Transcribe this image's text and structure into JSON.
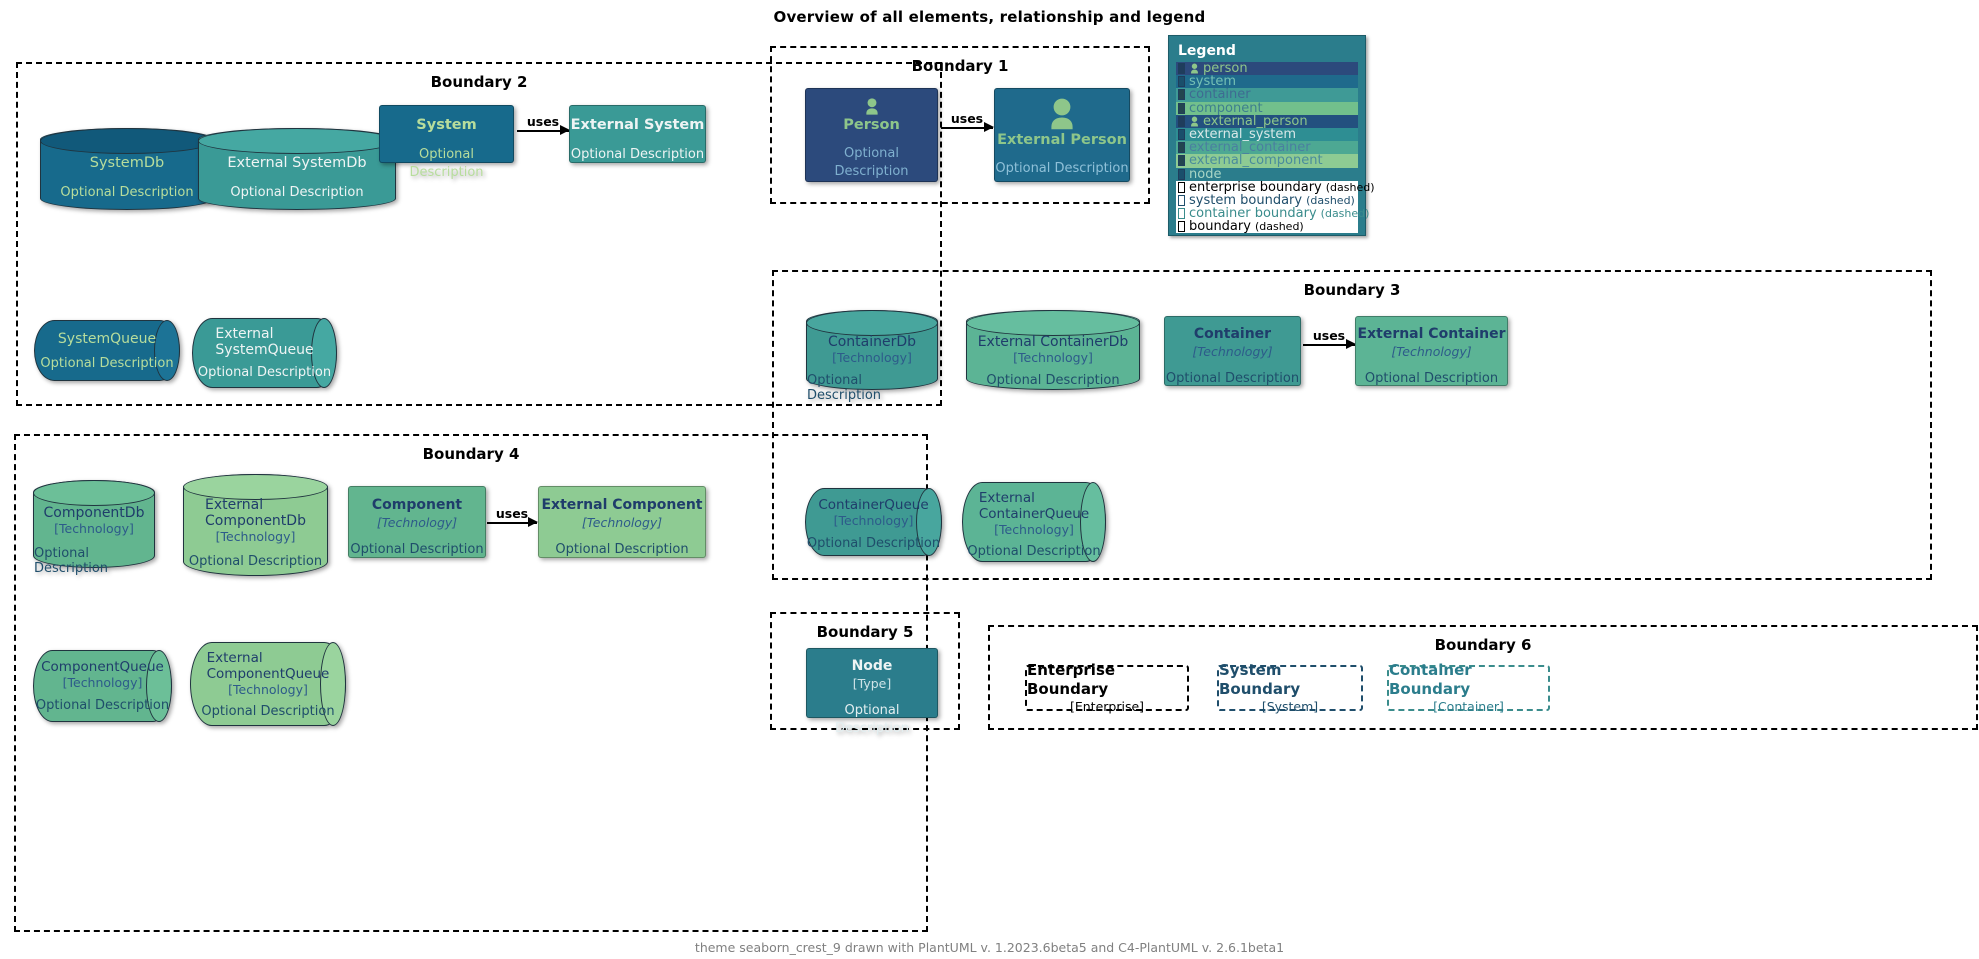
{
  "title": "Overview of all elements, relationship and legend",
  "footer": "theme seaborn_crest_9 drawn with PlantUML v. 1.2023.6beta5 and C4-PlantUML v. 2.6.1beta1",
  "labels": {
    "uses": "uses",
    "optional_description": "Optional Description",
    "technology": "[Technology]",
    "type": "[Type]",
    "dashed": "(dashed)"
  },
  "boundaries": {
    "b1": {
      "title": "Boundary 1"
    },
    "b2": {
      "title": "Boundary 2"
    },
    "b3": {
      "title": "Boundary 3"
    },
    "b4": {
      "title": "Boundary 4"
    },
    "b5": {
      "title": "Boundary 5"
    },
    "b6": {
      "title": "Boundary 6"
    }
  },
  "elements": {
    "person": {
      "name": "Person",
      "desc": "Optional Description"
    },
    "external_person": {
      "name": "External Person",
      "desc": "Optional Description"
    },
    "systemdb": {
      "name": "SystemDb",
      "desc": "Optional Description"
    },
    "external_systemdb": {
      "name": "External SystemDb",
      "desc": "Optional Description"
    },
    "system": {
      "name": "System",
      "desc": "Optional Description"
    },
    "external_system": {
      "name": "External System",
      "desc": "Optional Description"
    },
    "systemqueue": {
      "name": "SystemQueue",
      "desc": "Optional Description"
    },
    "external_systemqueue": {
      "name": "External\nSystemQueue",
      "desc": "Optional Description"
    },
    "containerdb": {
      "name": "ContainerDb",
      "tech": "[Technology]",
      "desc": "Optional Description"
    },
    "external_containerdb": {
      "name": "External ContainerDb",
      "tech": "[Technology]",
      "desc": "Optional Description"
    },
    "container": {
      "name": "Container",
      "tech": "[Technology]",
      "desc": "Optional Description"
    },
    "external_container": {
      "name": "External Container",
      "tech": "[Technology]",
      "desc": "Optional Description"
    },
    "containerqueue": {
      "name": "ContainerQueue",
      "tech": "[Technology]",
      "desc": "Optional Description"
    },
    "external_containerqueue": {
      "name": "External\nContainerQueue",
      "tech": "[Technology]",
      "desc": "Optional Description"
    },
    "componentdb": {
      "name": "ComponentDb",
      "tech": "[Technology]",
      "desc": "Optional Description"
    },
    "external_componentdb": {
      "name": "External\nComponentDb",
      "tech": "[Technology]",
      "desc": "Optional Description"
    },
    "component": {
      "name": "Component",
      "tech": "[Technology]",
      "desc": "Optional Description"
    },
    "external_component": {
      "name": "External Component",
      "tech": "[Technology]",
      "desc": "Optional Description"
    },
    "componentqueue": {
      "name": "ComponentQueue",
      "tech": "[Technology]",
      "desc": "Optional Description"
    },
    "external_componentqueue": {
      "name": "External\nComponentQueue",
      "tech": "[Technology]",
      "desc": "Optional Description"
    },
    "node": {
      "name": "Node",
      "tech": "[Type]",
      "desc": "Optional Description"
    },
    "enterprise_boundary": {
      "name": "Enterprise Boundary",
      "tech": "[Enterprise]"
    },
    "system_boundary": {
      "name": "System Boundary",
      "tech": "[System]"
    },
    "container_boundary": {
      "name": "Container Boundary",
      "tech": "[Container]"
    }
  },
  "relationships": [
    {
      "from": "System",
      "to": "External System",
      "label": "uses"
    },
    {
      "from": "Person",
      "to": "External Person",
      "label": "uses"
    },
    {
      "from": "Container",
      "to": "External Container",
      "label": "uses"
    },
    {
      "from": "Component",
      "to": "External Component",
      "label": "uses"
    }
  ],
  "legend": {
    "title": "Legend",
    "items": [
      {
        "label": "person",
        "icon": "person-icon",
        "row_bg": "#2c4a7c",
        "text": "#8ec68a",
        "swatch": "#1f3d5c"
      },
      {
        "label": "system",
        "icon": null,
        "row_bg": "#1f6a8c",
        "text": "#74c0b4",
        "swatch": "#1a4f6b"
      },
      {
        "label": "container",
        "icon": null,
        "row_bg": "#3f9a96",
        "text": "#3e6b92",
        "swatch": "#23454f"
      },
      {
        "label": "component",
        "icon": null,
        "row_bg": "#72c08c",
        "text": "#3e7f8e",
        "swatch": "#23454f"
      },
      {
        "label": "external_person",
        "icon": "person-icon",
        "row_bg": "#23507f",
        "text": "#8ec68a",
        "swatch": "#1f3d5c"
      },
      {
        "label": "external_system",
        "icon": null,
        "row_bg": "#2e8e93",
        "text": "#d8e8e8",
        "swatch": "#1a4f6b"
      },
      {
        "label": "external_container",
        "icon": null,
        "row_bg": "#4da893",
        "text": "#4a7fa0",
        "swatch": "#23454f"
      },
      {
        "label": "external_component",
        "icon": null,
        "row_bg": "#8ecb93",
        "text": "#4a8c9c",
        "swatch": "#23454f"
      },
      {
        "label": "node",
        "icon": null,
        "row_bg": "#2b7d8c",
        "text": "#a9d6c6",
        "swatch": "#1a4f6b"
      },
      {
        "label": "enterprise boundary",
        "suffix": "(dashed)",
        "row_bg": "#ffffff",
        "text": "#000000",
        "swatch": "#ffffff",
        "swatch_border": "#000000"
      },
      {
        "label": "system boundary",
        "suffix": "(dashed)",
        "row_bg": "#ffffff",
        "text": "#1f4e6b",
        "swatch": "#ffffff",
        "swatch_border": "#1f4e6b"
      },
      {
        "label": "container boundary",
        "suffix": "(dashed)",
        "row_bg": "#ffffff",
        "text": "#3a8c8c",
        "swatch": "#ffffff",
        "swatch_border": "#3a8c8c"
      },
      {
        "label": "boundary",
        "suffix": "(dashed)",
        "row_bg": "#ffffff",
        "text": "#000000",
        "swatch": "#ffffff",
        "swatch_border": "#000000"
      }
    ]
  },
  "colors": {
    "person_bg": "#2c4a7c",
    "external_person_bg": "#1f6a8c",
    "person_title": "#8ec68a",
    "systemdb_bg": "#176a8c",
    "external_systemdb_bg": "#3a9a96",
    "system_bg": "#176a8c",
    "external_system_bg": "#3a9a96",
    "container_bg": "#3f9a93",
    "external_container_bg": "#5cb495",
    "component_bg": "#62b58f",
    "external_component_bg": "#8ecb93",
    "node_bg": "#2b7d8c",
    "legend_bg": "#2b7d8c",
    "system_title_text": "#b7dd9c",
    "external_white_text": "#eef4f4",
    "container_title_text": "#1f3d6b",
    "boundary_line": "#000000"
  }
}
